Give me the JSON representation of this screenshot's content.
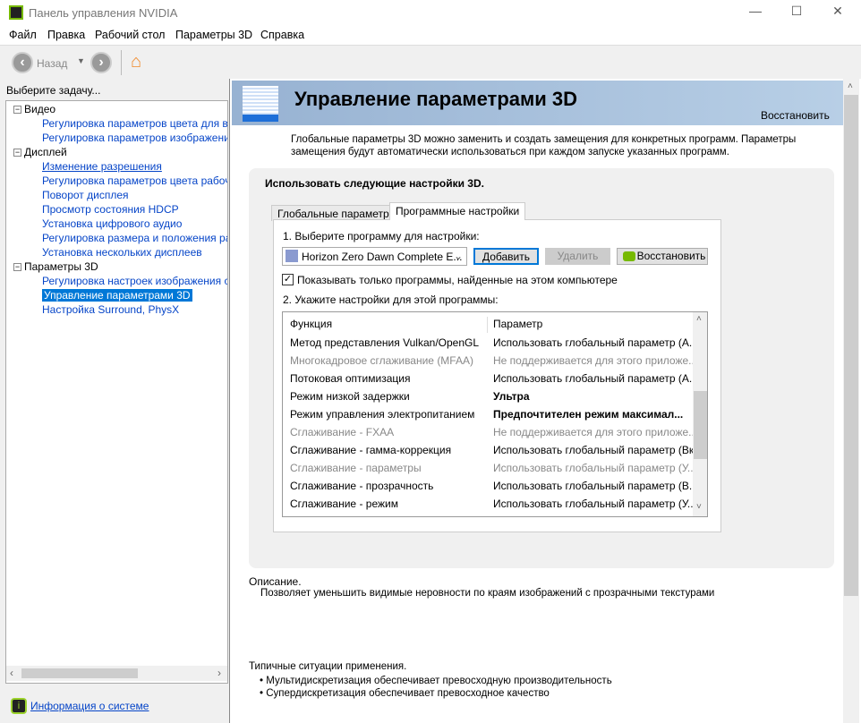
{
  "window": {
    "title": "Панель управления NVIDIA",
    "minimize": "—",
    "maximize": "☐",
    "close": "✕"
  },
  "menu": [
    "Файл",
    "Правка",
    "Рабочий стол",
    "Параметры 3D",
    "Справка"
  ],
  "toolbar": {
    "back_label": "Назад"
  },
  "left": {
    "heading": "Выберите задачу...",
    "tree": [
      {
        "label": "Видео",
        "level": 0
      },
      {
        "label": "Регулировка параметров цвета для видео",
        "level": 1
      },
      {
        "label": "Регулировка параметров изображения для видео",
        "level": 1
      },
      {
        "label": "Дисплей",
        "level": 0
      },
      {
        "label": "Изменение разрешения",
        "level": 1,
        "underline": true
      },
      {
        "label": "Регулировка параметров цвета рабочего стола",
        "level": 1
      },
      {
        "label": "Поворот дисплея",
        "level": 1
      },
      {
        "label": "Просмотр состояния HDCP",
        "level": 1
      },
      {
        "label": "Установка цифрового аудио",
        "level": 1
      },
      {
        "label": "Регулировка размера и положения рабочего стола",
        "level": 1
      },
      {
        "label": "Установка нескольких дисплеев",
        "level": 1
      },
      {
        "label": "Параметры 3D",
        "level": 0
      },
      {
        "label": "Регулировка настроек изображения с просмотром",
        "level": 1
      },
      {
        "label": "Управление параметрами 3D",
        "level": 1,
        "selected": true
      },
      {
        "label": "Настройка Surround, PhysX",
        "level": 1
      }
    ],
    "system_info": "Информация о системе"
  },
  "header": {
    "title": "Управление параметрами 3D",
    "restore": "Восстановить"
  },
  "intro": "Глобальные параметры 3D можно заменить и создать замещения для конкретных программ. Параметры замещения будут автоматически использоваться при каждом запуске указанных программ.",
  "group": {
    "title": "Использовать следующие настройки 3D.",
    "tabs": [
      "Глобальные параметры",
      "Программные настройки"
    ],
    "step1": "1. Выберите программу для настройки:",
    "program": "Horizon Zero Dawn Complete E...",
    "add": "Добавить",
    "remove": "Удалить",
    "restore": "Восстановить",
    "checkbox": "Показывать только программы, найденные на этом компьютере",
    "checked": true,
    "step2": "2. Укажите настройки для этой программы:",
    "columns": [
      "Функция",
      "Параметр"
    ],
    "rows": [
      {
        "f": "Метод представления Vulkan/OpenGL",
        "p": "Использовать глобальный параметр (А..."
      },
      {
        "f": "Многокадровое сглаживание (MFAA)",
        "p": "Не поддерживается для этого приложе...",
        "disabled": true
      },
      {
        "f": "Потоковая оптимизация",
        "p": "Использовать глобальный параметр (А..."
      },
      {
        "f": "Режим низкой задержки",
        "p": "Ультра",
        "bold": true
      },
      {
        "f": "Режим управления электропитанием",
        "p": "Предпочтителен режим максимал...",
        "bold": true
      },
      {
        "f": "Сглаживание - FXAA",
        "p": "Не поддерживается для этого приложе...",
        "disabled": true
      },
      {
        "f": "Сглаживание - гамма-коррекция",
        "p": "Использовать глобальный параметр (Вкл)"
      },
      {
        "f": "Сглаживание - параметры",
        "p": "Использовать глобальный параметр (У...",
        "disabled": true
      },
      {
        "f": "Сглаживание - прозрачность",
        "p": "Использовать глобальный параметр (В..."
      },
      {
        "f": "Сглаживание - режим",
        "p": "Использовать глобальный параметр (У..."
      }
    ]
  },
  "description": {
    "label": "Описание.",
    "text": "Позволяет уменьшить видимые неровности по краям изображений с прозрачными текстурами"
  },
  "typical": {
    "label": "Типичные ситуации применения.",
    "items": [
      "Мультидискретизация обеспечивает превосходную производительность",
      "Супердискретизация обеспечивает превосходное качество"
    ]
  }
}
